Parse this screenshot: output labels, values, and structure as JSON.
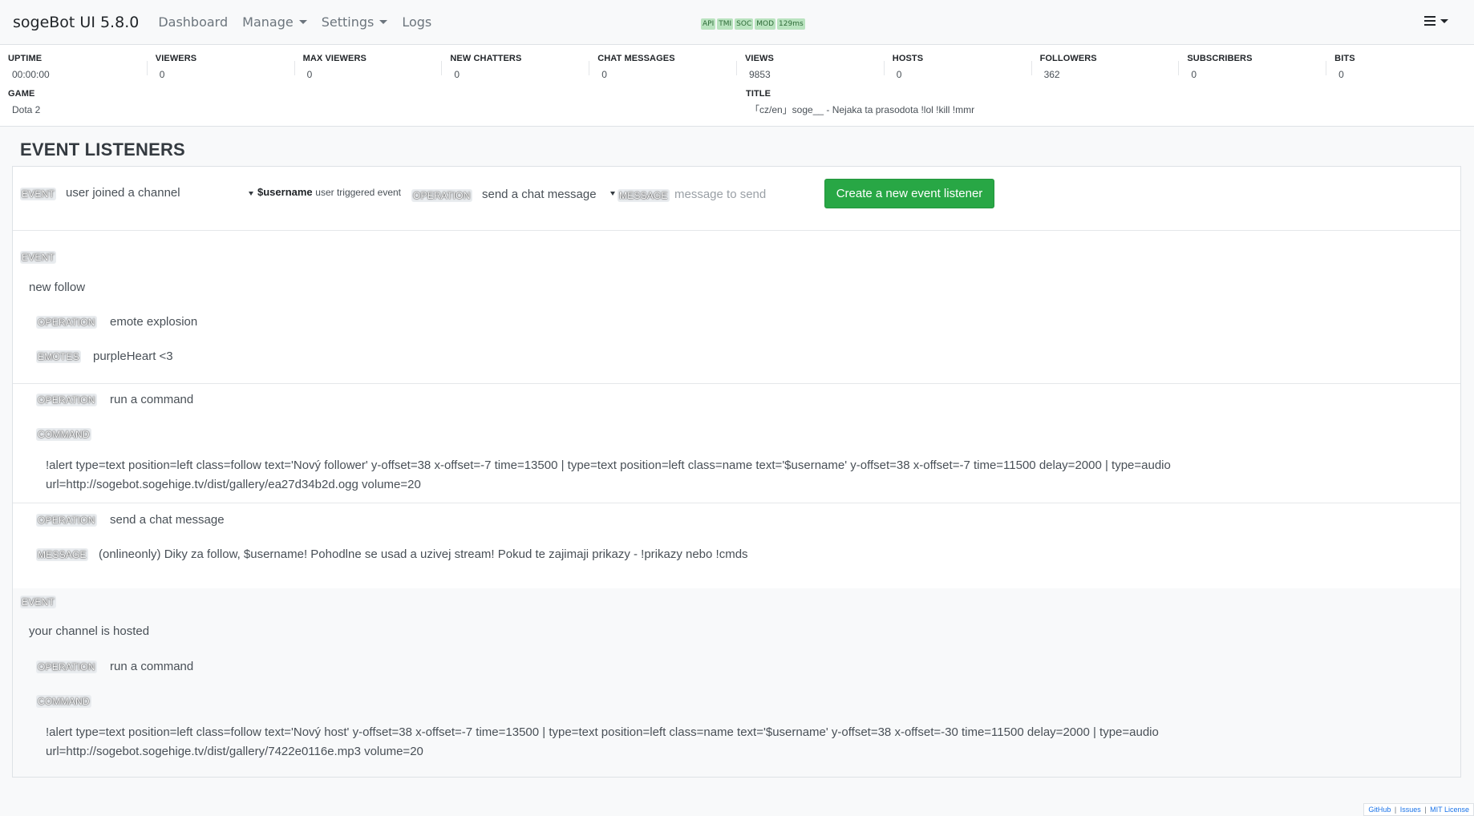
{
  "navbar": {
    "brand": "sogeBot UI 5.8.0",
    "dashboard": "Dashboard",
    "manage": "Manage",
    "settings": "Settings",
    "logs": "Logs",
    "status": [
      "API",
      "TMI",
      "SOC",
      "MOD",
      "129ms"
    ]
  },
  "stats": {
    "row1": [
      {
        "label": "UPTIME",
        "value": "00:00:00"
      },
      {
        "label": "VIEWERS",
        "value": "0"
      },
      {
        "label": "MAX VIEWERS",
        "value": "0"
      },
      {
        "label": "NEW CHATTERS",
        "value": "0"
      },
      {
        "label": "CHAT MESSAGES",
        "value": "0"
      },
      {
        "label": "VIEWS",
        "value": "9853"
      },
      {
        "label": "HOSTS",
        "value": "0"
      },
      {
        "label": "FOLLOWERS",
        "value": "362"
      },
      {
        "label": "SUBSCRIBERS",
        "value": "0"
      },
      {
        "label": "BITS",
        "value": "0"
      }
    ],
    "game_label": "GAME",
    "game_value": "Dota 2",
    "title_label": "TITLE",
    "title_value": "「cz/en」soge__ - Nejaka ta prasodota !lol !kill !mmr"
  },
  "section_title": "EVENT LISTENERS",
  "form": {
    "event_tag": "EVENT",
    "event_value": "user joined a channel",
    "variable_name": "$username",
    "variable_desc": "user triggered event",
    "operation_tag": "OPERATION",
    "operation_value": "send a chat message",
    "message_tag": "MESSAGE",
    "message_placeholder": "message to send",
    "create_button": "Create a new event listener"
  },
  "listeners": {
    "follow": {
      "event_tag": "EVENT",
      "event_name": "new follow",
      "op1_tag": "OPERATION",
      "op1_value": "emote explosion",
      "emotes_tag": "EMOTES",
      "emotes_value": "purpleHeart <3",
      "op2_tag": "OPERATION",
      "op2_value": "run a command",
      "command_tag": "COMMAND",
      "command_value": "!alert type=text position=left class=follow text='Nový follower' y-offset=38 x-offset=-7 time=13500 | type=text position=left class=name text='$username' y-offset=38 x-offset=-7 time=11500 delay=2000 | type=audio url=http://sogebot.sogehige.tv/dist/gallery/ea27d34b2d.ogg volume=20",
      "op3_tag": "OPERATION",
      "op3_value": "send a chat message",
      "message_tag": "MESSAGE",
      "message_value": "(onlineonly) Diky za follow, $username! Pohodlne se usad a uzivej stream! Pokud te zajimaji prikazy - !prikazy nebo !cmds"
    },
    "hosted": {
      "event_tag": "EVENT",
      "event_name": "your channel is hosted",
      "op1_tag": "OPERATION",
      "op1_value": "run a command",
      "command_tag": "COMMAND",
      "command_value": "!alert type=text position=left class=follow text='Nový host' y-offset=38 x-offset=-7 time=13500 | type=text position=left class=name text='$username' y-offset=38 x-offset=-30 time=11500 delay=2000 | type=audio url=http://sogebot.sogehige.tv/dist/gallery/7422e0116e.mp3 volume=20"
    }
  },
  "footer": {
    "github": "GitHub",
    "issues": "Issues",
    "license": "MIT License",
    "separator": "|"
  }
}
